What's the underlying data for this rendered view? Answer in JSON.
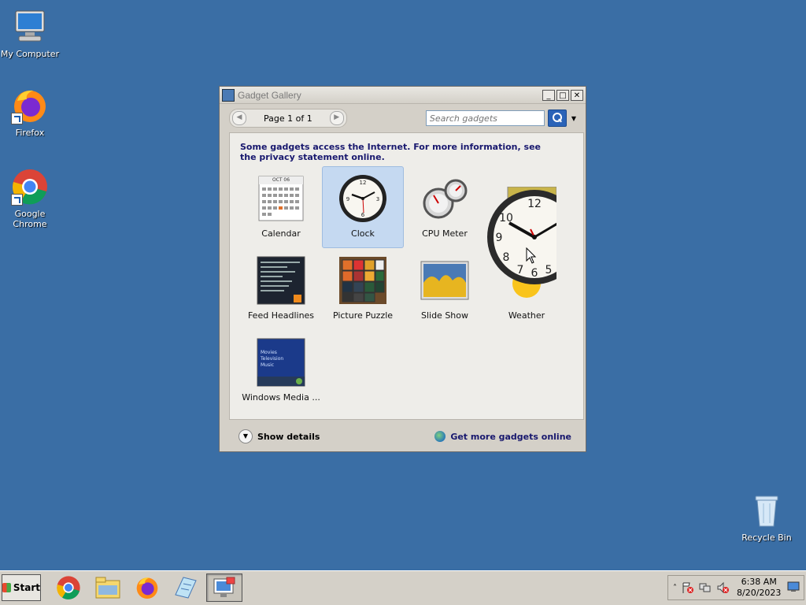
{
  "desktop": {
    "icons": [
      {
        "label": "My Computer"
      },
      {
        "label": "Firefox"
      },
      {
        "label": "Google Chrome"
      },
      {
        "label": "Recycle Bin"
      }
    ]
  },
  "window": {
    "title": "Gadget Gallery",
    "pager": {
      "text": "Page 1 of 1"
    },
    "search": {
      "placeholder": "Search gadgets"
    },
    "notice": "Some gadgets access the Internet.  For more information, see the privacy statement online.",
    "gadgets": [
      {
        "name": "Calendar",
        "icon": "calendar-icon",
        "selected": false
      },
      {
        "name": "Clock",
        "icon": "clock-icon",
        "selected": true
      },
      {
        "name": "CPU Meter",
        "icon": "cpu-meter-icon",
        "selected": false
      },
      {
        "name": "Feed Headlines",
        "icon": "feed-icon",
        "selected": false
      },
      {
        "name": "Picture Puzzle",
        "icon": "puzzle-icon",
        "selected": false
      },
      {
        "name": "Slide Show",
        "icon": "slideshow-icon",
        "selected": false
      },
      {
        "name": "Weather",
        "icon": "weather-icon",
        "selected": false
      },
      {
        "name": "Windows Media ...",
        "icon": "media-center-icon",
        "selected": false
      }
    ],
    "calendar_month": "OCT 06",
    "media_center_lines": [
      "Movies",
      "Television",
      "Music"
    ],
    "footer": {
      "show_details": "Show details",
      "get_more": "Get more gadgets online"
    }
  },
  "taskbar": {
    "start_label": "Start",
    "clock_time": "6:38 AM",
    "clock_date": "8/20/2023"
  },
  "colors": {
    "desktop": "#3a6ea5",
    "selection": "#c5d9f1",
    "notice_text": "#18186e"
  }
}
